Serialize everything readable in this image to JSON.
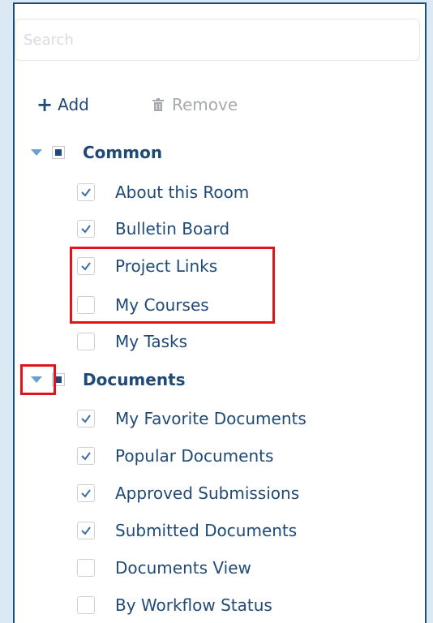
{
  "search": {
    "placeholder": "Search"
  },
  "toolbar": {
    "add_label": "Add",
    "remove_label": "Remove"
  },
  "groups": [
    {
      "label": "Common",
      "items": [
        {
          "label": "About this Room",
          "checked": true
        },
        {
          "label": "Bulletin Board",
          "checked": true
        },
        {
          "label": "Project Links",
          "checked": true
        },
        {
          "label": "My Courses",
          "checked": false
        },
        {
          "label": "My Tasks",
          "checked": false
        }
      ]
    },
    {
      "label": "Documents",
      "items": [
        {
          "label": "My Favorite Documents",
          "checked": true
        },
        {
          "label": "Popular Documents",
          "checked": true
        },
        {
          "label": "Approved Submissions",
          "checked": true
        },
        {
          "label": "Submitted Documents",
          "checked": true
        },
        {
          "label": "Documents View",
          "checked": false
        },
        {
          "label": "By Workflow Status",
          "checked": false
        }
      ]
    }
  ],
  "colors": {
    "text": "#1f4a75",
    "caret": "#6a9fd2",
    "highlight": "#e2141a",
    "frame": "#1b4f78",
    "backdrop": "#dbe9f5"
  }
}
